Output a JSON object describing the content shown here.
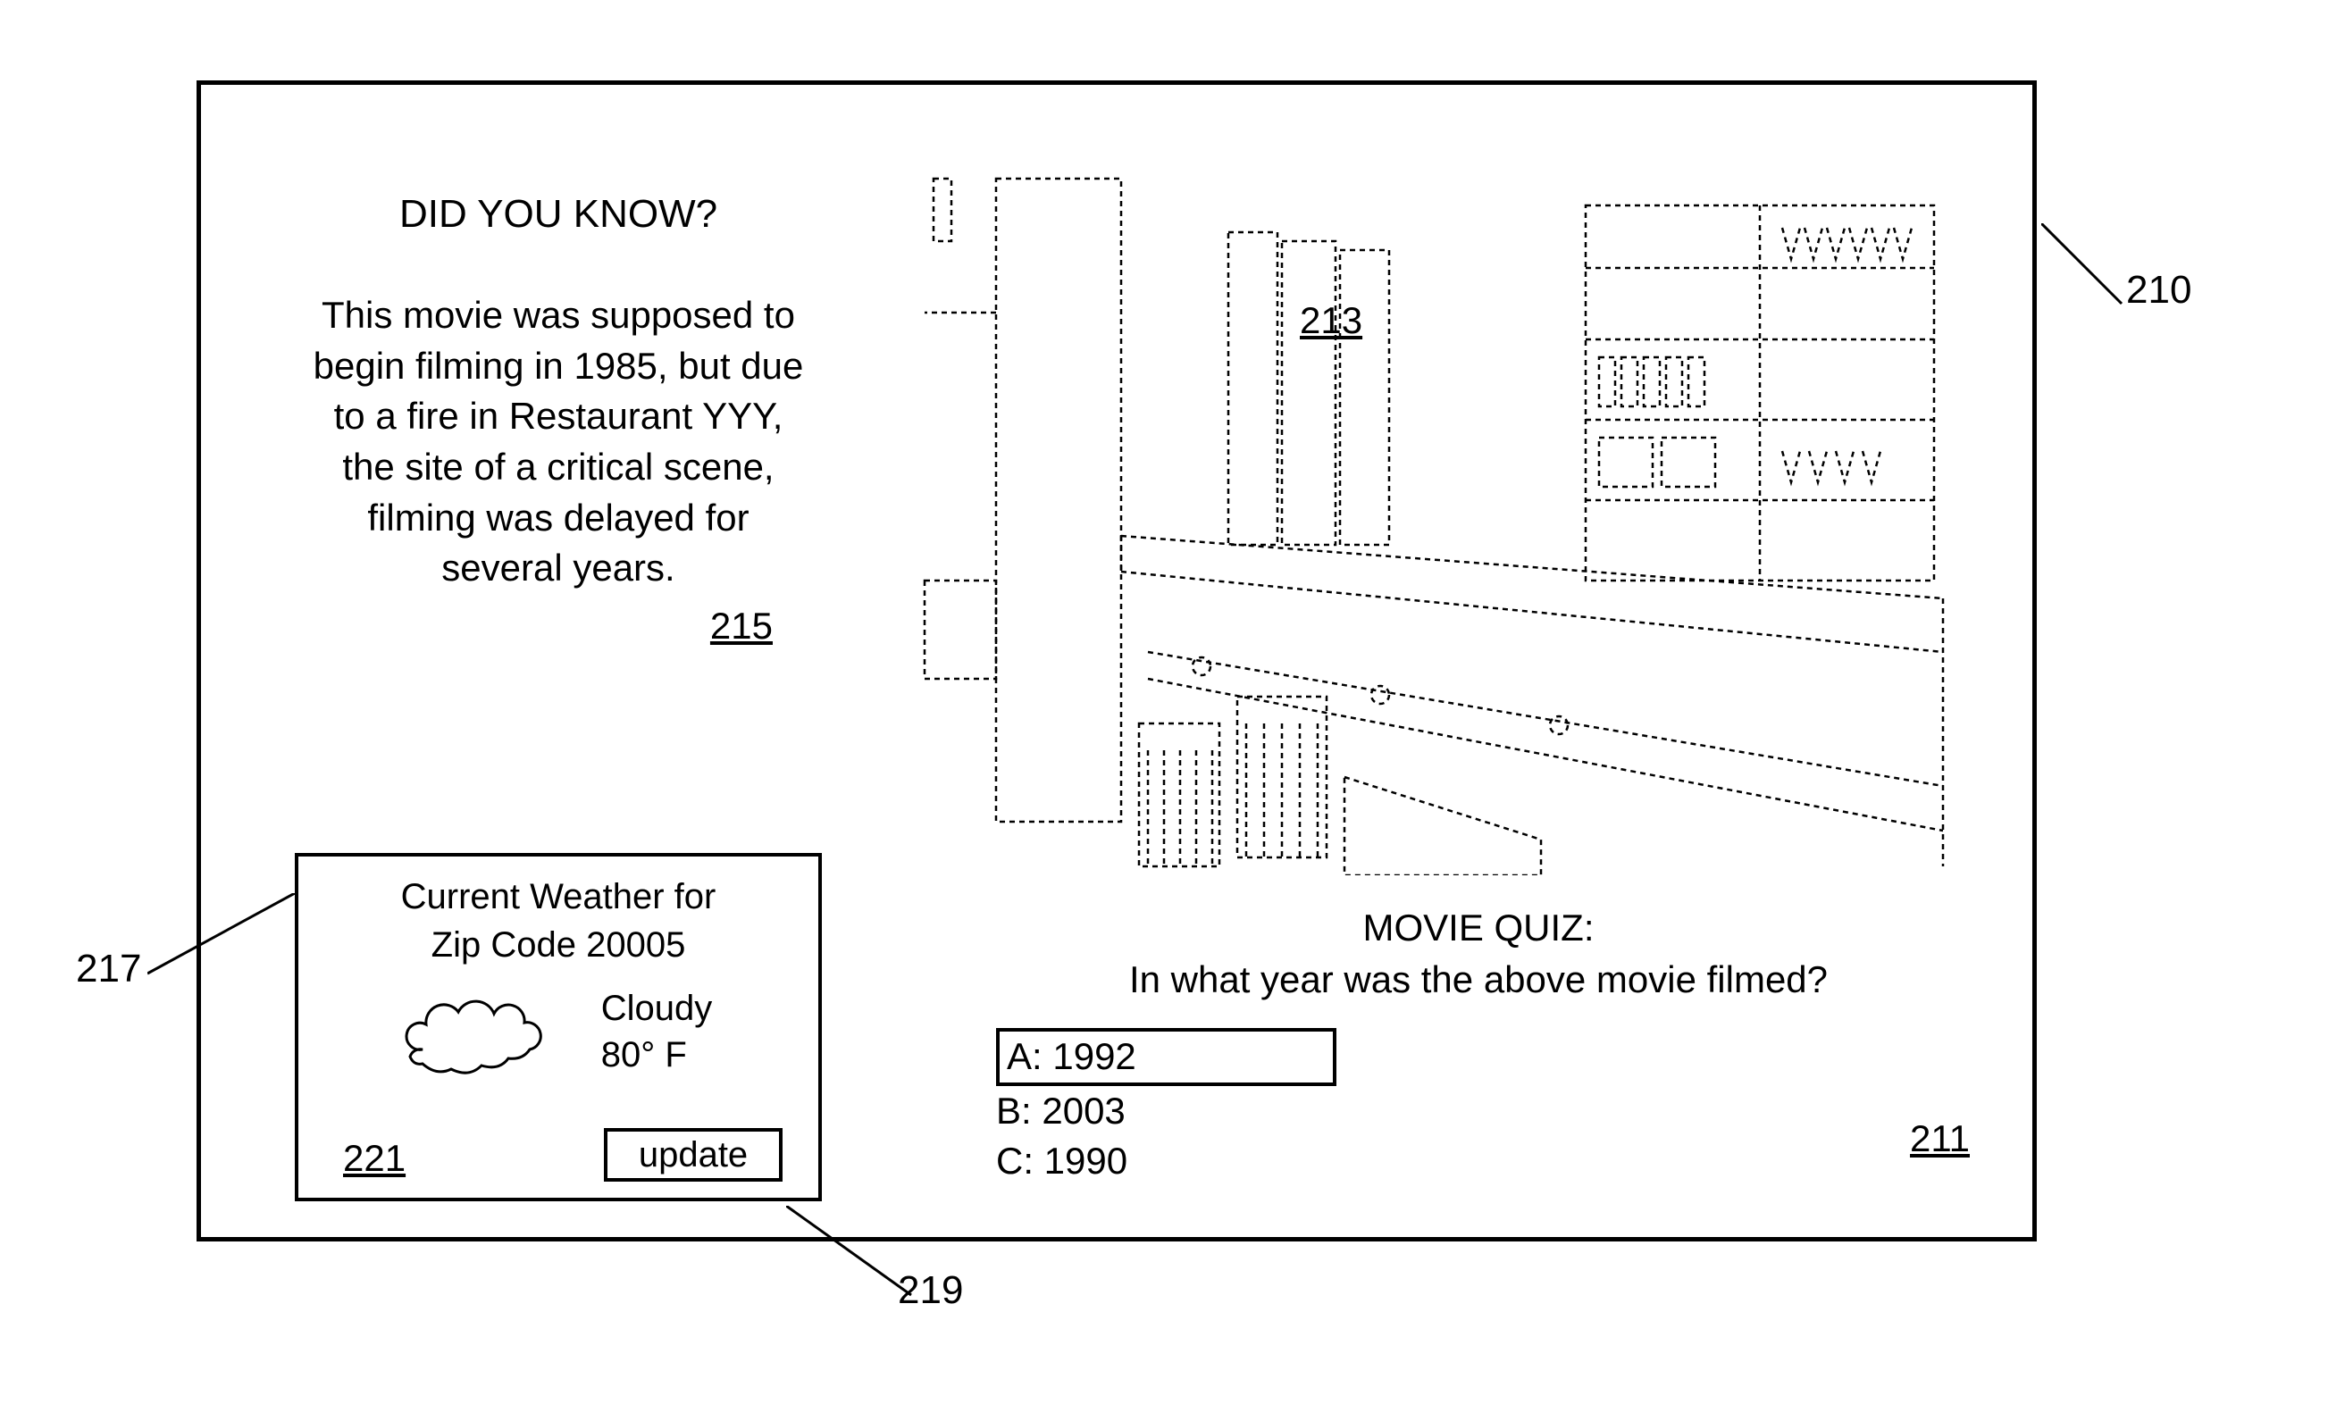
{
  "trivia": {
    "heading": "DID YOU KNOW?",
    "body": "This movie was supposed to begin filming in 1985, but due to a fire in Restaurant YYY, the site of a critical scene, filming was delayed for several years.",
    "ref": "215"
  },
  "weather": {
    "title_line1": "Current Weather for",
    "title_line2": "Zip Code 20005",
    "condition": "Cloudy",
    "temperature": "80° F",
    "update_label": "update",
    "ref": "221"
  },
  "scene": {
    "ref": "213"
  },
  "quiz": {
    "heading": "MOVIE QUIZ:",
    "question": "In what year was the above movie filmed?",
    "answers": [
      {
        "label": "A: 1992",
        "selected": true
      },
      {
        "label": "B: 2003",
        "selected": false
      },
      {
        "label": "C: 1990",
        "selected": false
      }
    ],
    "ref": "211"
  },
  "callouts": {
    "screen": "210",
    "weather_widget": "217",
    "update_button": "219"
  }
}
